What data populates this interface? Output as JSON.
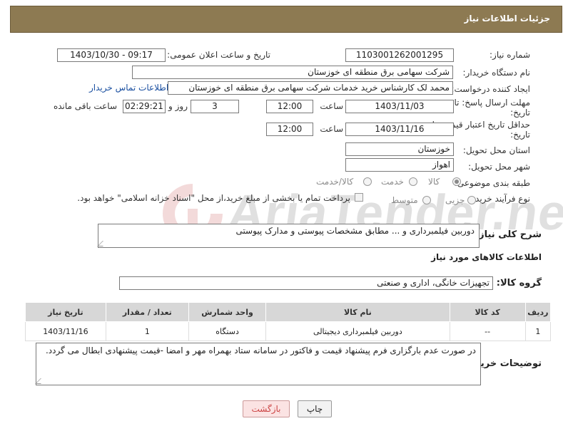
{
  "header": {
    "title": "جزئیات اطلاعات نیاز"
  },
  "form": {
    "need_number_label": "شماره نیاز:",
    "need_number": "1103001262001295",
    "announce_label": "تاریخ و ساعت اعلان عمومی:",
    "announce_value": "1403/10/30 - 09:17",
    "buyer_org_label": "نام دستگاه خریدار:",
    "buyer_org": "شرکت سهامی برق منطقه ای خوزستان",
    "requester_label": "ایجاد کننده درخواست:",
    "requester": "محمد لک کارشناس خرید خدمات شرکت سهامی برق منطقه ای خوزستان",
    "contact_link": "اطلاعات تماس خریدار",
    "reply_deadline_label": "مهلت ارسال پاسخ: تا",
    "reply_deadline_label2": "تاریخ:",
    "reply_date": "1403/11/03",
    "time_label": "ساعت",
    "reply_time": "12:00",
    "days_value": "3",
    "days_label": "روز و",
    "remaining_time": "02:29:21",
    "remaining_label": "ساعت باقی مانده",
    "price_validity_label": "حداقل تاریخ اعتبار قیمت: تا",
    "price_validity_label2": "تاریخ:",
    "price_date": "1403/11/16",
    "price_time": "12:00",
    "province_label": "استان محل تحویل:",
    "province": "خوزستان",
    "city_label": "شهر محل تحویل:",
    "city": "اهواز",
    "category_label": "طبقه بندی موضوعی:",
    "category_options": [
      "کالا",
      "خدمت",
      "کالا/خدمت"
    ],
    "category_selected": "کالا",
    "process_label": "نوع فرآیند خرید :",
    "process_options": [
      "جزیی",
      "متوسط"
    ],
    "payment_note": "پرداخت تمام یا بخشی از مبلغ خرید،از محل \"اسناد خزانه اسلامی\" خواهد بود."
  },
  "summary": {
    "label": "شرح کلی نیاز:",
    "value": "دوربین فیلمبرداری و ... مطابق مشخصات پیوستی و مدارک پیوستی"
  },
  "goods_section": {
    "title": "اطلاعات کالاهای مورد نیاز",
    "group_label": "گروه کالا:",
    "group_value": "تجهیزات خانگی، اداری و صنعتی"
  },
  "table": {
    "headers": [
      "ردیف",
      "کد کالا",
      "نام کالا",
      "واحد شمارش",
      "تعداد / مقدار",
      "تاریخ نیاز"
    ],
    "rows": [
      [
        "1",
        "--",
        "دوربین فیلمبرداری دیجیتالی",
        "دستگاه",
        "1",
        "1403/11/16"
      ]
    ]
  },
  "buyer_notes": {
    "label": "توضیحات خریدار:",
    "value": "در صورت عدم بارگزاری فرم پیشنهاد قیمت و فاکتور در سامانه ستاد بهمراه مهر و امضا -قیمت پیشنهادی ابطال می گردد."
  },
  "buttons": {
    "print": "چاپ",
    "back": "بازگشت"
  },
  "watermark": {
    "text": "AriaTender.neT"
  },
  "colors": {
    "header_bg": "#8d7a52",
    "table_header_bg": "#d7d7d7",
    "link": "#1a4fa0",
    "back_button_bg": "#fbe3e3"
  }
}
